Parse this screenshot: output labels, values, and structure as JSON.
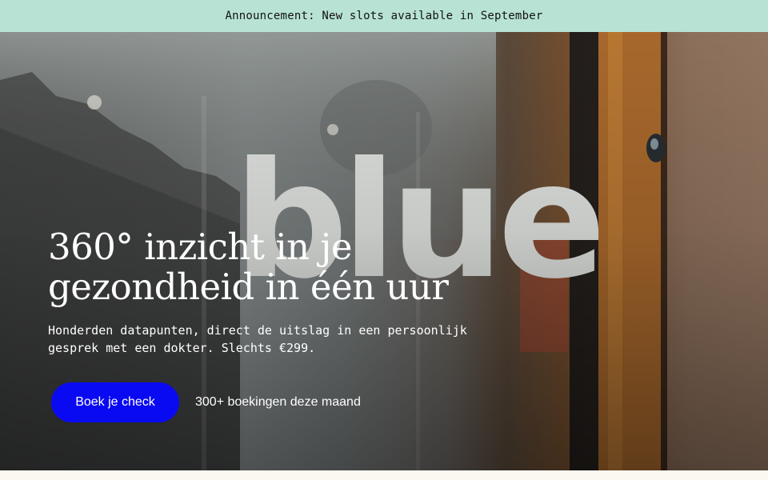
{
  "announcement": {
    "text": "Announcement: New slots available in September"
  },
  "hero": {
    "logo_text": "blue",
    "title_line1": "360° inzicht in je",
    "title_line2": "gezondheid in één uur",
    "subtitle_line1": "Honderden datapunten, direct de uitslag in een persoonlijk",
    "subtitle_line2": "gesprek met een dokter. Slechts €299.",
    "cta_label": "Boek je check",
    "cta_note": "300+ boekingen deze maand"
  },
  "colors": {
    "announcement_bg": "#b8e3d4",
    "cta_bg": "#0a0af2",
    "page_bg": "#fbf8f1"
  }
}
